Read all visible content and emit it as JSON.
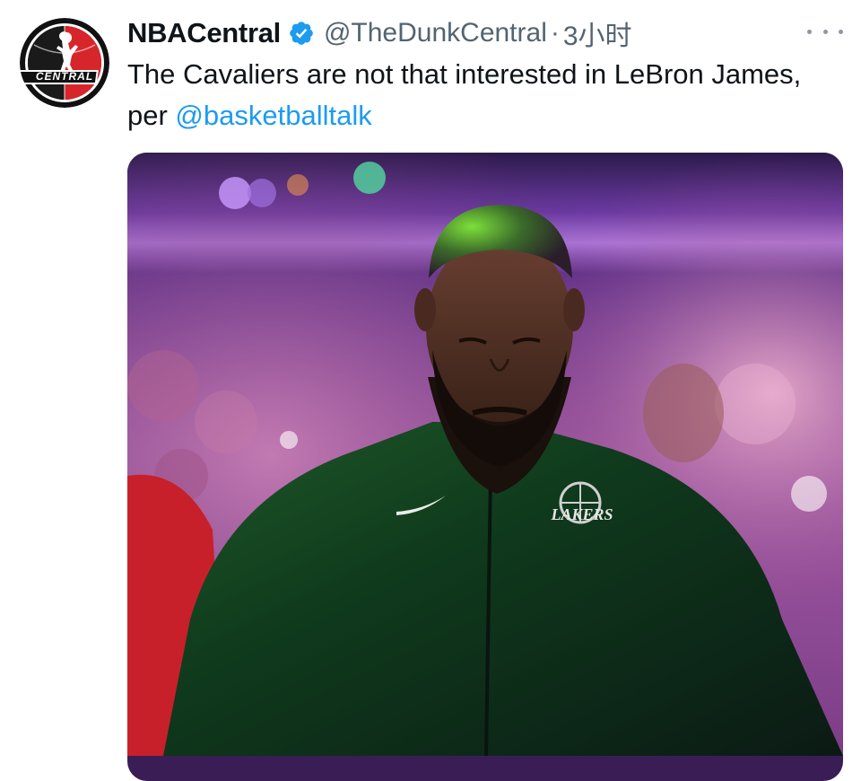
{
  "tweet": {
    "display_name": "NBACentral",
    "handle": "@TheDunkCentral",
    "separator": "·",
    "time": "3小时",
    "text_before_mention": "The Cavaliers are not that interested in LeBron James, per ",
    "mention": "@basketballtalk",
    "avatar": {
      "label": "CENTRAL",
      "colors": {
        "ring": "#111111",
        "red": "#d7262b",
        "white": "#ffffff"
      }
    },
    "verified_icon": "verified-badge-icon",
    "more_icon": "more-options-icon",
    "media": {
      "icon": "photo",
      "jersey_logo_text": "LAKERS"
    }
  },
  "colors": {
    "text": "#0f1419",
    "secondary": "#536471",
    "link": "#1d9bf0",
    "verified": "#1d9bf0"
  }
}
